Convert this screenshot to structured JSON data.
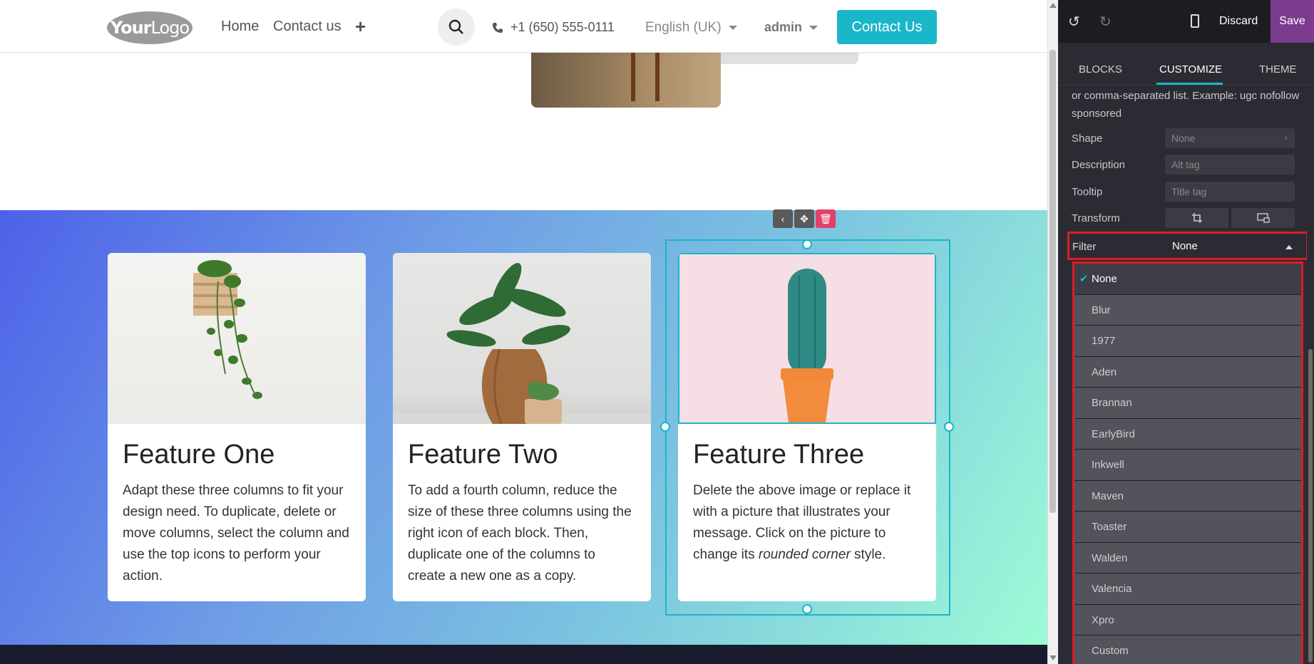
{
  "navbar": {
    "logo_text": "YourLogo",
    "links": [
      "Home",
      "Contact us"
    ],
    "phone": "+1 (650) 555-0111",
    "language": "English (UK)",
    "user": "admin",
    "cta": "Contact Us"
  },
  "cards": [
    {
      "title": "Feature One",
      "body": "Adapt these three columns to fit your design need. To duplicate, delete or move columns, select the column and use the top icons to perform your action."
    },
    {
      "title": "Feature Two",
      "body": "To add a fourth column, reduce the size of these three columns using the right icon of each block. Then, duplicate one of the columns to create a new one as a copy."
    },
    {
      "title": "Feature Three",
      "body_pre": "Delete the above image or replace it with a picture that illustrates your message. Click on the picture to change its ",
      "body_em": "rounded corner",
      "body_post": " style."
    }
  ],
  "editor": {
    "discard": "Discard",
    "save": "Save",
    "tabs": [
      "BLOCKS",
      "CUSTOMIZE",
      "THEME"
    ],
    "active_tab": "CUSTOMIZE",
    "help_text": "or comma-separated list. Example: ugc nofollow sponsored",
    "rows": {
      "shape_label": "Shape",
      "shape_value": "None",
      "description_label": "Description",
      "description_placeholder": "Alt tag",
      "tooltip_label": "Tooltip",
      "tooltip_placeholder": "Title tag",
      "transform_label": "Transform",
      "filter_label": "Filter",
      "filter_value": "None"
    },
    "filter_options": [
      "None",
      "Blur",
      "1977",
      "Aden",
      "Brannan",
      "EarlyBird",
      "Inkwell",
      "Maven",
      "Toaster",
      "Walden",
      "Valencia",
      "Xpro",
      "Custom"
    ],
    "selected_filter": "None"
  },
  "colors": {
    "accent": "#1ab6c9",
    "save_purple": "#7b3c8f",
    "highlight_red": "#e01b24"
  }
}
